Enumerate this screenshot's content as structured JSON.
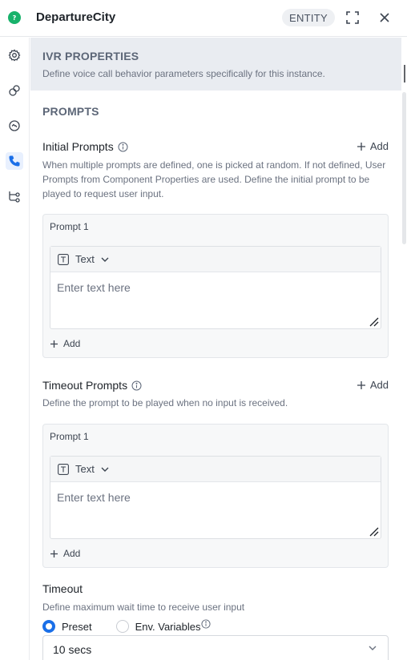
{
  "header": {
    "title": "DepartureCity",
    "badge": "ENTITY",
    "logo_icon": "chat-bubble-logo-icon",
    "accent_green": "#18b26b"
  },
  "rail": {
    "items": [
      {
        "icon": "gear-icon",
        "active": false
      },
      {
        "icon": "link-icon",
        "active": false
      },
      {
        "icon": "refresh-icon",
        "active": false
      },
      {
        "icon": "phone-icon",
        "active": true
      },
      {
        "icon": "flow-icon",
        "active": false
      }
    ],
    "active_color": "#1a6fe8"
  },
  "ivr": {
    "title": "IVR PROPERTIES",
    "description": "Define voice call behavior parameters specifically for this instance."
  },
  "prompts": {
    "section_title": "PROMPTS",
    "initial": {
      "title": "Initial Prompts",
      "add_label": "Add",
      "help": "When multiple prompts are defined, one is picked at random. If not defined, User Prompts from Component Properties are used. Define the initial prompt to be played to request user input.",
      "card_label": "Prompt 1",
      "type_label": "Text",
      "placeholder": "Enter text here",
      "inner_add_label": "Add"
    },
    "timeout": {
      "title": "Timeout Prompts",
      "add_label": "Add",
      "help": "Define the prompt to be played when no input is received.",
      "card_label": "Prompt 1",
      "type_label": "Text",
      "placeholder": "Enter text here",
      "inner_add_label": "Add"
    }
  },
  "timeout": {
    "title": "Timeout",
    "help": "Define maximum wait time to receive user input",
    "options": [
      "Preset",
      "Env. Variables"
    ],
    "selected_option": "Preset",
    "selected_value": "10 secs"
  }
}
